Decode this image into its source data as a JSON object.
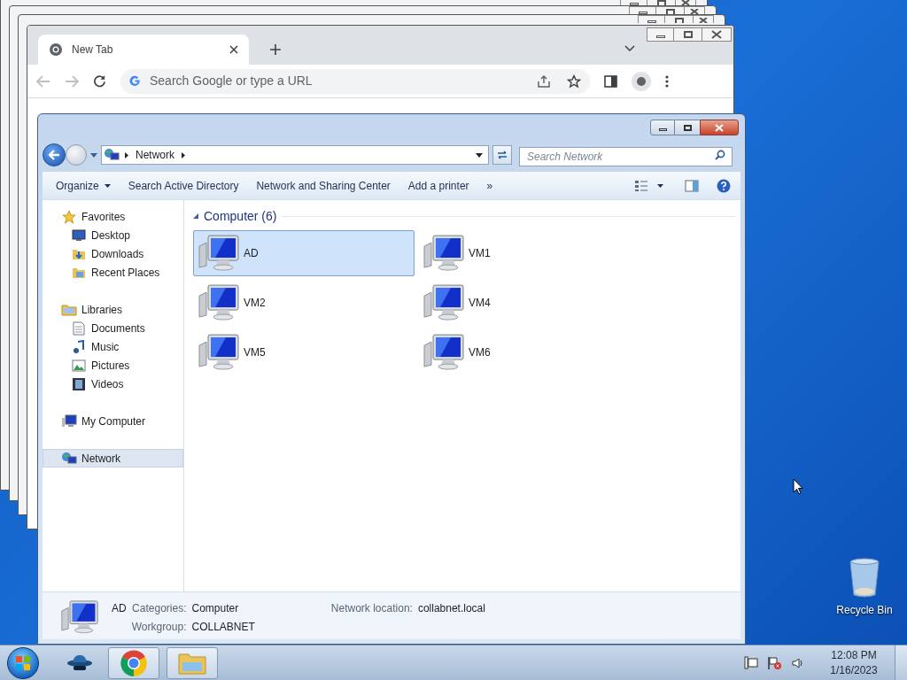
{
  "browser": {
    "tab": {
      "title": "New Tab",
      "selected": true
    },
    "omnibox": {
      "placeholder": "Search Google or type a URL"
    }
  },
  "explorer": {
    "address": {
      "crumbs": [
        "Network"
      ]
    },
    "search": {
      "placeholder": "Search Network"
    },
    "commands": [
      {
        "label": "Organize",
        "kind": "menu"
      },
      {
        "label": "Search Active Directory",
        "kind": "action"
      },
      {
        "label": "Network and Sharing Center",
        "kind": "action"
      },
      {
        "label": "Add a printer",
        "kind": "action"
      },
      {
        "label": "»",
        "kind": "more"
      }
    ],
    "nav": [
      {
        "label": "Favorites",
        "kind": "star",
        "selected": false,
        "children": [
          {
            "label": "Desktop",
            "kind": "desktop",
            "selected": false
          },
          {
            "label": "Downloads",
            "kind": "downloads",
            "selected": false
          },
          {
            "label": "Recent Places",
            "kind": "recent",
            "selected": false
          }
        ]
      },
      {
        "label": "Libraries",
        "kind": "libraries",
        "selected": false,
        "children": [
          {
            "label": "Documents",
            "kind": "documents",
            "selected": false
          },
          {
            "label": "Music",
            "kind": "music",
            "selected": false
          },
          {
            "label": "Pictures",
            "kind": "pictures",
            "selected": false
          },
          {
            "label": "Videos",
            "kind": "videos",
            "selected": false
          }
        ]
      },
      {
        "label": "My Computer",
        "kind": "computer",
        "selected": false
      },
      {
        "label": "Network",
        "kind": "network",
        "selected": true
      }
    ],
    "group": {
      "title": "Computer (6)"
    },
    "items": [
      {
        "name": "AD",
        "selected": true
      },
      {
        "name": "VM1",
        "selected": false
      },
      {
        "name": "VM2",
        "selected": false
      },
      {
        "name": "VM4",
        "selected": false
      },
      {
        "name": "VM5",
        "selected": false
      },
      {
        "name": "VM6",
        "selected": false
      }
    ],
    "details": {
      "name": "AD",
      "columns": [
        [
          {
            "label": "Categories:",
            "value": "Computer"
          },
          {
            "label": "Workgroup:",
            "value": "COLLABNET"
          }
        ],
        [
          {
            "label": "Network location:",
            "value": "collabnet.local"
          }
        ]
      ]
    }
  },
  "desktop_icons": [
    {
      "label": "Recycle Bin"
    }
  ],
  "taskbar": {
    "apps": [
      {
        "kind": "spy",
        "open": false
      },
      {
        "kind": "chrome",
        "open": true
      },
      {
        "kind": "explorer",
        "open": true
      }
    ],
    "clock": {
      "time": "12:08 PM",
      "date": "1/16/2023"
    }
  }
}
